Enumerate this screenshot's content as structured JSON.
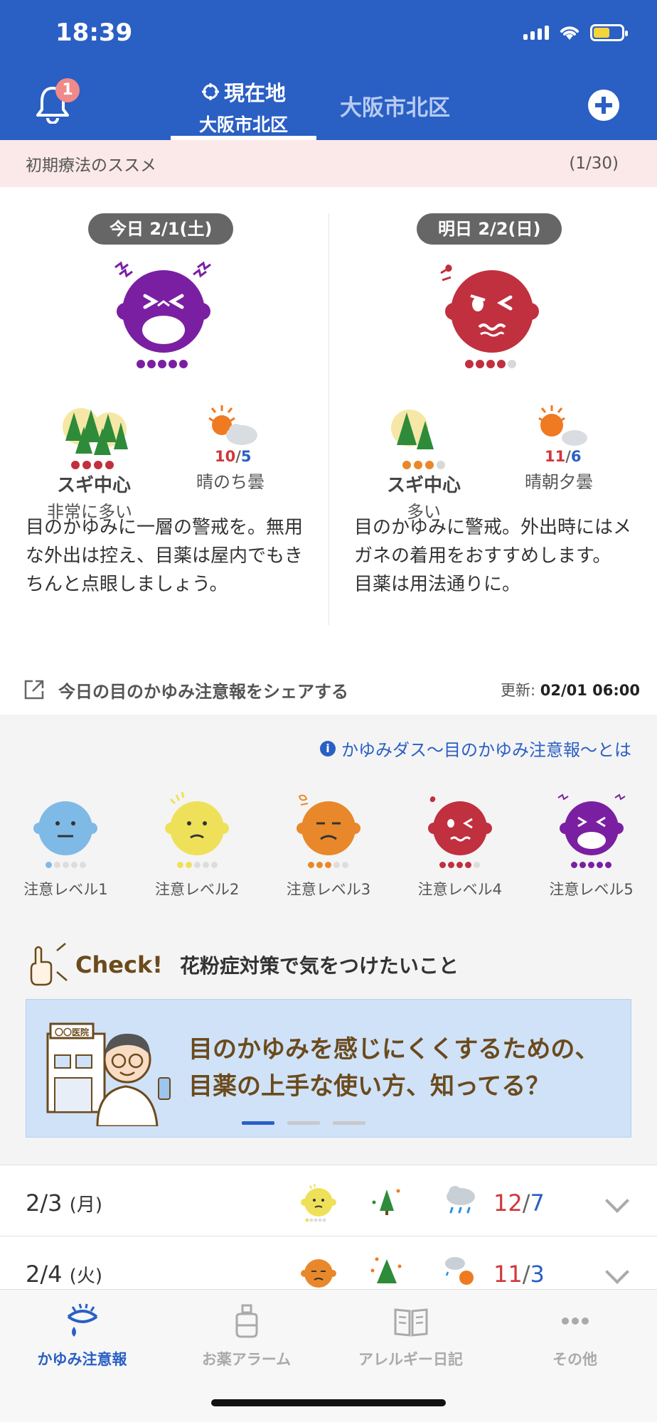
{
  "status_bar": {
    "time": "18:39"
  },
  "header": {
    "notification_count": "1",
    "current_tab": {
      "label": "現在地",
      "sublabel": "大阪市北区"
    },
    "other_tab": {
      "label": "大阪市北区"
    }
  },
  "notice": {
    "text": "初期療法のススメ",
    "counter": "(1/30)"
  },
  "forecast": {
    "today": {
      "date_label": "今日 2/1(土)",
      "level": 5,
      "face_color": "#7b1fa2",
      "pollen_level_dots": 4,
      "pollen_main": "スギ中心",
      "pollen_sub": "非常に多い",
      "temp_high": "10",
      "temp_low": "5",
      "weather": "晴のち曇",
      "advice": "目のかゆみに一層の警戒を。無用な外出は控え、目薬は屋内でもきちんと点眼しましょう。"
    },
    "tomorrow": {
      "date_label": "明日 2/2(日)",
      "level": 4,
      "face_color": "#c0303f",
      "pollen_level_dots": 3,
      "pollen_main": "スギ中心",
      "pollen_sub": "多い",
      "temp_high": "11",
      "temp_low": "6",
      "weather": "晴朝夕曇",
      "advice": "目のかゆみに警戒。外出時にはメガネの着用をおすすめします。 目薬は用法通りに。"
    }
  },
  "share": {
    "label": "今日の目のかゆみ注意報をシェアする",
    "updated_prefix": "更新:",
    "updated_value": "02/01 06:00"
  },
  "info_link": "かゆみダス〜目のかゆみ注意報〜とは",
  "levels": [
    {
      "label": "注意レベル1",
      "color": "#7fb9e6"
    },
    {
      "label": "注意レベル2",
      "color": "#efe05a"
    },
    {
      "label": "注意レベル3",
      "color": "#e8882b"
    },
    {
      "label": "注意レベル4",
      "color": "#c0303f"
    },
    {
      "label": "注意レベル5",
      "color": "#7b1fa2"
    }
  ],
  "check": {
    "badge": "Check!",
    "title": "花粉症対策で気をつけたいこと"
  },
  "banner": {
    "sign": "〇〇医院",
    "line1": "目のかゆみを感じにくくするための、",
    "line2": "目薬の上手な使い方、知ってる？",
    "active_page": 1,
    "pages": 3
  },
  "daily_list": [
    {
      "date": "2/3",
      "weekday": "(月)",
      "temp_high": "12",
      "temp_low": "7",
      "level": 2
    },
    {
      "date": "2/4",
      "weekday": "(火)",
      "temp_high": "11",
      "temp_low": "3",
      "level": 3
    }
  ],
  "bottom_nav": [
    {
      "label": "かゆみ注意報",
      "icon": "eye-icon",
      "active": true
    },
    {
      "label": "お薬アラーム",
      "icon": "eye-drop-icon",
      "active": false
    },
    {
      "label": "アレルギー日記",
      "icon": "book-icon",
      "active": false
    },
    {
      "label": "その他",
      "icon": "more-icon",
      "active": false
    }
  ],
  "colors": {
    "brand": "#2a5fc4",
    "notice_bg": "#fbe8e8",
    "temp_high": "#d0373b",
    "temp_low": "#2a5fc4"
  }
}
